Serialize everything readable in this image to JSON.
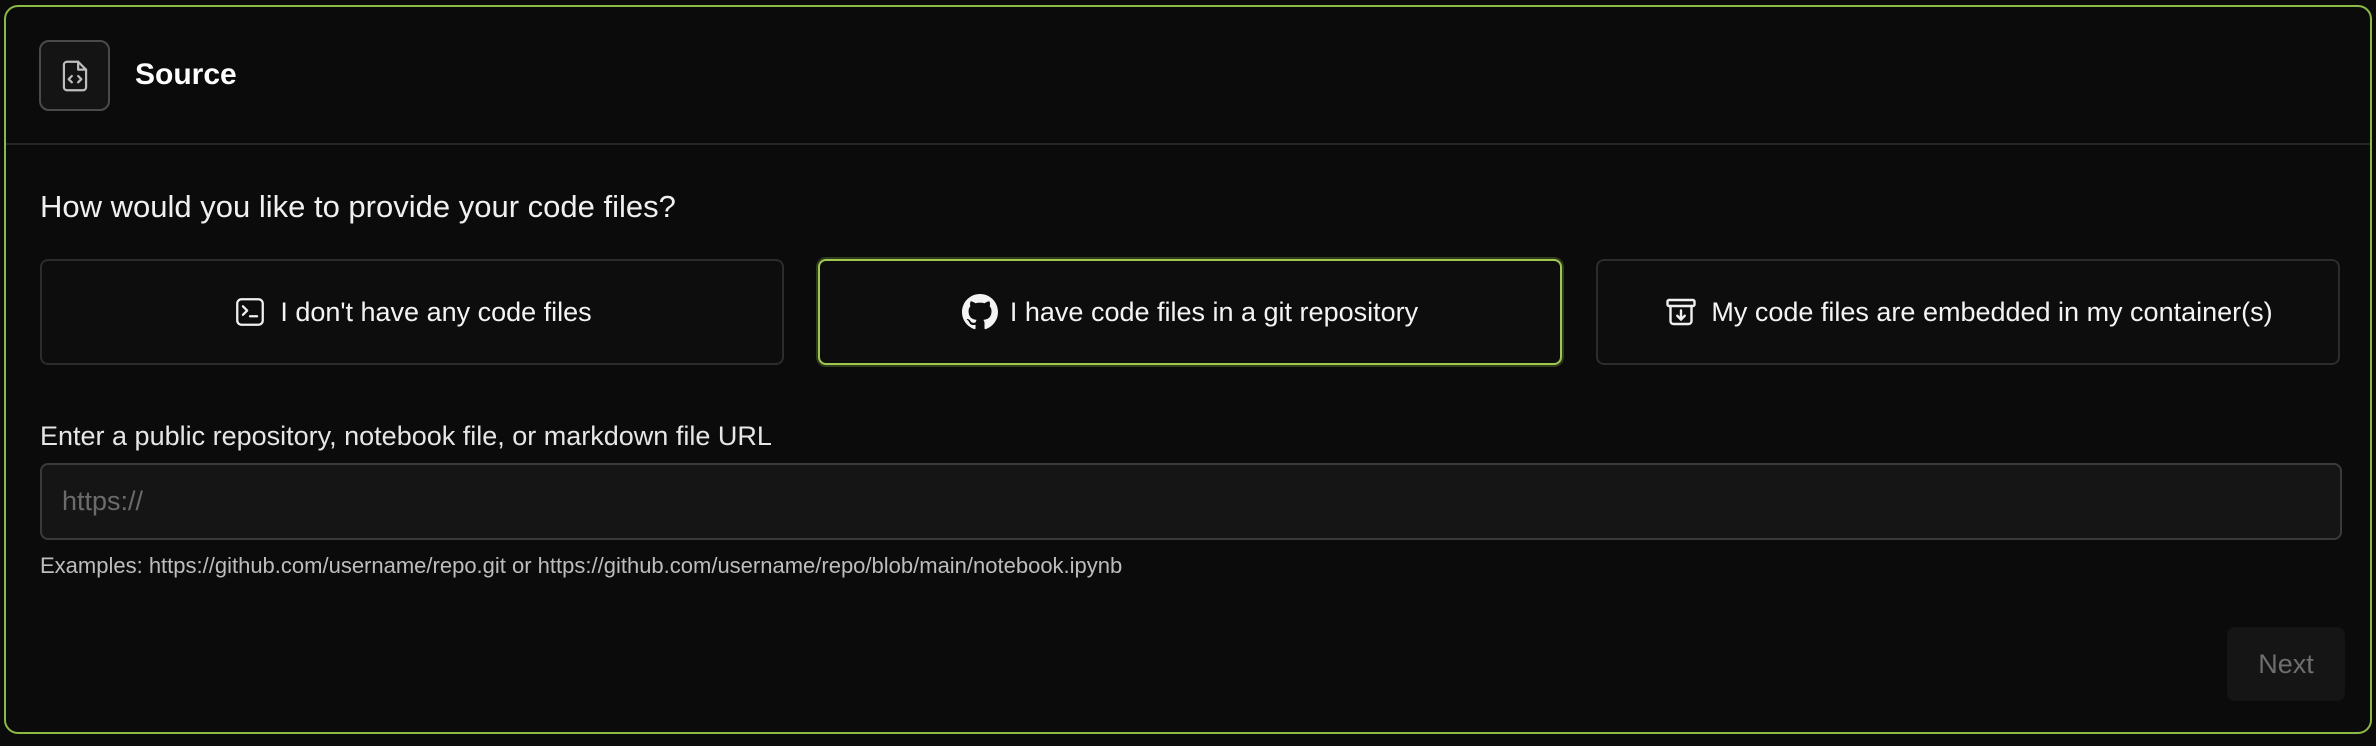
{
  "header": {
    "title": "Source",
    "icon": "file-code-icon"
  },
  "question": "How would you like to provide your code files?",
  "options": [
    {
      "label": "I don't have any code files",
      "icon": "terminal-icon",
      "selected": false
    },
    {
      "label": "I have code files in a git repository",
      "icon": "github-icon",
      "selected": true
    },
    {
      "label": "My code files are embedded in my container(s)",
      "icon": "archive-download-icon",
      "selected": false
    }
  ],
  "url_field": {
    "label": "Enter a public repository, notebook file, or markdown file URL",
    "placeholder": "https://",
    "value": "",
    "help": "Examples: https://github.com/username/repo.git or https://github.com/username/repo/blob/main/notebook.ipynb"
  },
  "actions": {
    "next_label": "Next",
    "next_disabled": true
  },
  "colors": {
    "accent": "#a0c850",
    "background": "#0b0b0b"
  }
}
